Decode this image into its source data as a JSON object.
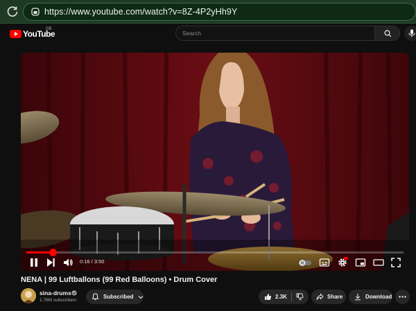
{
  "browser": {
    "url": "https://www.youtube.com/watch?v=8Z-4P2yHh9Y"
  },
  "header": {
    "logo_text": "YouTube",
    "region": "GB",
    "search_placeholder": "Search"
  },
  "player": {
    "time": "0:16 / 3:50",
    "progress_fraction": 0.07,
    "colors": {
      "progress": "#ff0000",
      "curtain": "#5a0a10"
    }
  },
  "video": {
    "title": "NENA | 99 Luftballons (99 Red Balloons) • Drum Cover"
  },
  "channel": {
    "name": "sina-drums",
    "subscribers": "1.76M subscribers",
    "subscribe_label": "Subscribed"
  },
  "actions": {
    "likes": "2.3K",
    "share_label": "Share",
    "download_label": "Download"
  },
  "icons": [
    "reload-icon",
    "lock-icon",
    "search-icon",
    "mic-icon",
    "pause-icon",
    "next-icon",
    "volume-icon",
    "autoplay-toggle",
    "subtitles-icon",
    "settings-icon",
    "miniplayer-icon",
    "theater-icon",
    "fullscreen-icon",
    "bell-icon",
    "chevron-down-icon",
    "thumbs-up-icon",
    "thumbs-down-icon",
    "share-icon",
    "download-icon",
    "more-icon"
  ]
}
